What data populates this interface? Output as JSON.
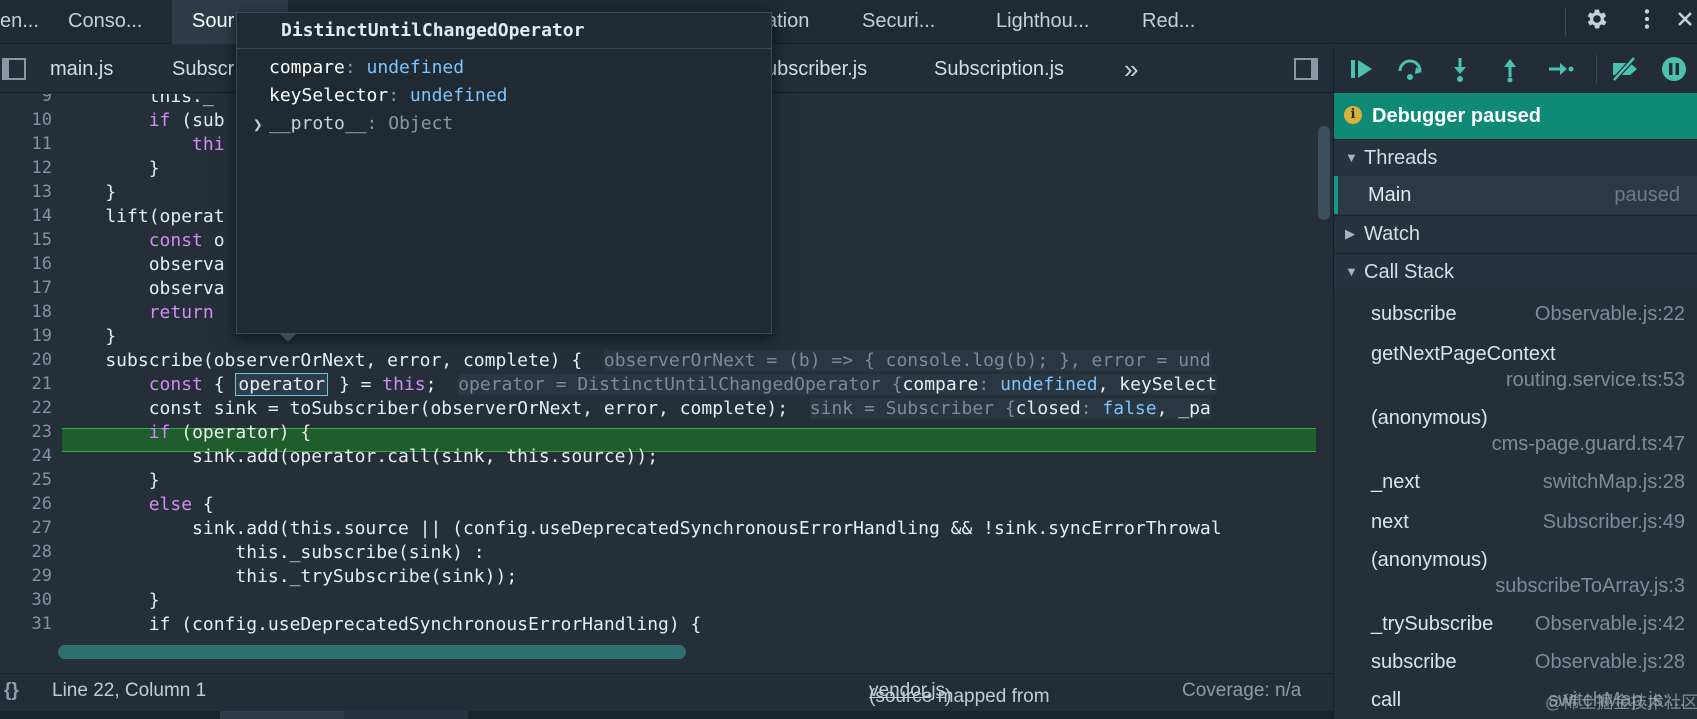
{
  "top_tabs": [
    {
      "label": "en..."
    },
    {
      "label": "Conso..."
    },
    {
      "label": "Sour"
    },
    {
      "label": "ation"
    },
    {
      "label": "Securi..."
    },
    {
      "label": "Lighthou..."
    },
    {
      "label": "Red..."
    }
  ],
  "file_tabs": [
    {
      "label": "main.js"
    },
    {
      "label": "Subscr"
    },
    {
      "label": "ubscriber.js"
    },
    {
      "label": "Subscription.js"
    },
    {
      "label": "»"
    }
  ],
  "popover": {
    "title": "DistinctUntilChangedOperator",
    "rows": [
      {
        "key": "compare",
        "value": "undefined"
      },
      {
        "key": "keySelector",
        "value": "undefined"
      }
    ],
    "proto_key": "__proto__",
    "proto_value": "Object"
  },
  "editor": {
    "lines": [
      {
        "n": "9",
        "code": "        this._"
      },
      {
        "n": "10",
        "code": ""
      },
      {
        "n": "11",
        "code": "        }"
      },
      {
        "n": "12",
        "code": "    }"
      },
      {
        "n": "13",
        "code": "    lift(operat"
      },
      {
        "n": "14",
        "code": "        const o"
      },
      {
        "n": "15",
        "code": "        observa"
      },
      {
        "n": "16",
        "code": "        observa"
      },
      {
        "n": "17",
        "code": "        return"
      },
      {
        "n": "18",
        "code": "    }"
      },
      {
        "n": "19",
        "code": "    subscribe(observerOrNext, error, complete) {"
      },
      {
        "n": "20",
        "code": ""
      },
      {
        "n": "21",
        "code": "        const sink = toSubscriber(observerOrNext, error, complete);"
      },
      {
        "n": "22",
        "code": ""
      },
      {
        "n": "23",
        "code": "            sink.add(operator.call(sink, this.source));"
      },
      {
        "n": "24",
        "code": "        }"
      },
      {
        "n": "25",
        "code": "        else {"
      },
      {
        "n": "26",
        "code": "            sink.add(this.source || (config.useDeprecatedSynchronousErrorHandling && !sink.syncErrorThrowal"
      },
      {
        "n": "27",
        "code": "                this._subscribe(sink) :"
      },
      {
        "n": "28",
        "code": "                this._trySubscribe(sink));"
      },
      {
        "n": "29",
        "code": "        }"
      },
      {
        "n": "30",
        "code": "        if (config.useDeprecatedSynchronousErrorHandling) {"
      },
      {
        "n": "31",
        "code": ""
      }
    ],
    "line9_tail": "this._",
    "line9_visible": "this._",
    "line10_kw": "if",
    "line10_rest": " (sub",
    "line11_kw": "thi",
    "inline19": "observerOrNext = (b) => { console.log(b); }, error = und",
    "line20_const": "const",
    "line20_a": " { ",
    "line20_op": "operator",
    "line20_b": " } = ",
    "line20_this": "this",
    "line20_c": ";",
    "inline20_a": "operator = DistinctUntilChangedOperator {",
    "inline20_compare": "compare",
    "inline20_colon": ": ",
    "inline20_undef": "undefined",
    "inline20_rest": ", keySelect",
    "inline21_a": "sink = Subscriber {",
    "inline21_closed": "closed",
    "inline21_colon": ": ",
    "inline21_false": "false",
    "inline21_rest": ", _pa",
    "line22_kw": "if",
    "line22_rest": " (operator) {"
  },
  "status": {
    "braces": "{}",
    "position": "Line 22, Column 1",
    "source_prefix": "(source mapped from ",
    "source_link": "vendor.js",
    "source_suffix": ")",
    "coverage": "Coverage: n/a"
  },
  "debugger": {
    "banner": "Debugger paused",
    "threads_label": "Threads",
    "thread_name": "Main",
    "thread_status": "paused",
    "watch_label": "Watch",
    "callstack_label": "Call Stack",
    "frames": [
      {
        "name": "subscribe",
        "loc": "Observable.js:22"
      },
      {
        "name": "getNextPageContext",
        "loc": "routing.service.ts:53"
      },
      {
        "name": "(anonymous)",
        "loc": "cms-page.guard.ts:47"
      },
      {
        "name": "_next",
        "loc": "switchMap.js:28"
      },
      {
        "name": "next",
        "loc": "Subscriber.js:49"
      },
      {
        "name": "(anonymous)",
        "loc": "subscribeToArray.js:3"
      },
      {
        "name": "_trySubscribe",
        "loc": "Observable.js:42"
      },
      {
        "name": "subscribe",
        "loc": "Observable.js:28"
      },
      {
        "name": "call",
        "loc": "switchMap.js:..."
      }
    ]
  },
  "watermark": "@稀土掘金技术社区",
  "colors": {
    "accent": "#0f8a76",
    "exec_line": "#1f5e2c",
    "keyword": "#d38cf3",
    "value": "#7fc4ff"
  }
}
